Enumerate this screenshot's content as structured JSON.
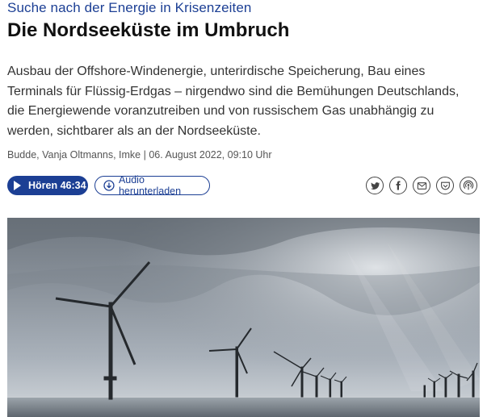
{
  "article": {
    "kicker": "Suche nach der Energie in Krisenzeiten",
    "headline": "Die Nordseeküste im Umbruch",
    "teaser_lines": [
      "Ausbau der Offshore-Windenergie, unterirdische Speicherung, Bau eines",
      "Terminals für Flüssig-Erdgas – nirgendwo sind die Bemühungen Deutschlands,",
      "die Energiewende voranzutreiben und von russischem Gas unabhängig zu",
      "werden, sichtbarer als an der Nordseeküste."
    ],
    "byline": "Budde, Vanja Oltmanns, Imke | 06. August 2022, 09:10 Uhr"
  },
  "audio": {
    "play_label": "Hören 46:34",
    "download_label": "Audio herunterladen"
  },
  "share": {
    "icons": [
      "twitter-icon",
      "facebook-icon",
      "email-icon",
      "pocket-icon",
      "podcast-icon"
    ]
  },
  "colors": {
    "accent": "#1c3f94",
    "text": "#333333"
  }
}
